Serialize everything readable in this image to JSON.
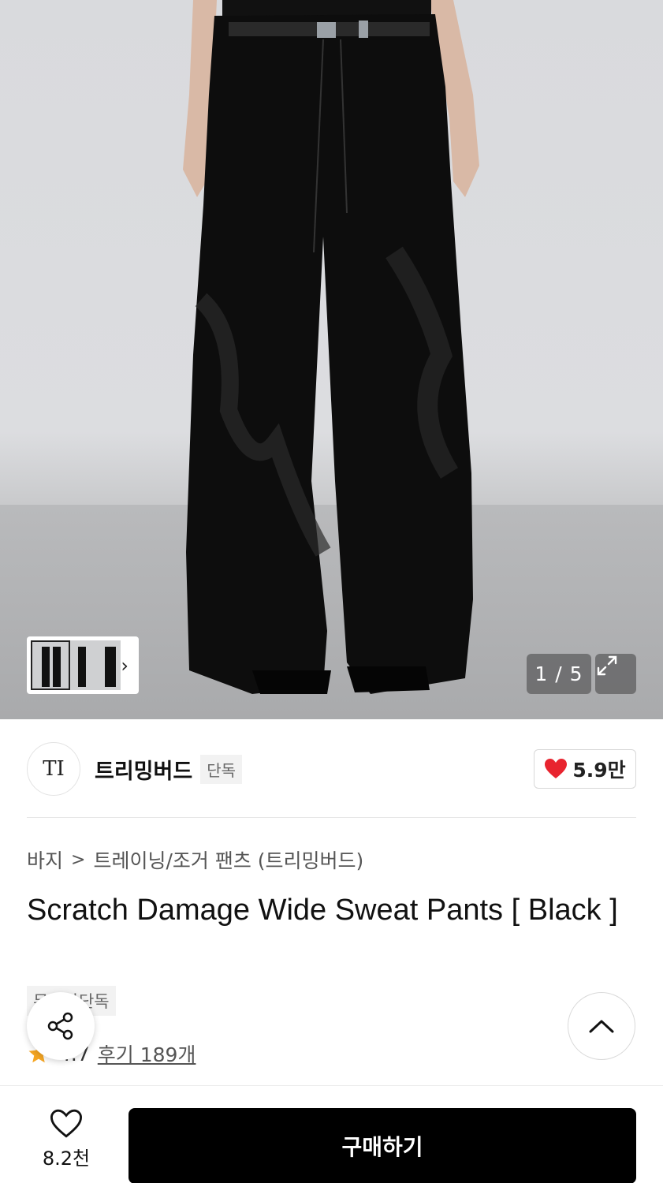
{
  "gallery": {
    "counter": "1 / 5",
    "thumbs_next": "›"
  },
  "brand": {
    "logo_text": "TI",
    "name": "트리밍버드",
    "badge": "단독",
    "likes": "5.9만"
  },
  "breadcrumb": {
    "category": "바지",
    "separator": ">",
    "subcategory": "트레이닝/조거 팬츠 (트리밍버드)"
  },
  "product": {
    "title": "Scratch Damage Wide Sweat Pants [ Black ]",
    "exclusive_badge": "무신사단독",
    "rating": "4.7",
    "reviews": "후기 189개"
  },
  "bottom": {
    "wish_count": "8.2천",
    "buy_label": "구매하기"
  },
  "colors": {
    "accent_red": "#e8242f",
    "star": "#f5a623",
    "buy_button": "#000000"
  }
}
